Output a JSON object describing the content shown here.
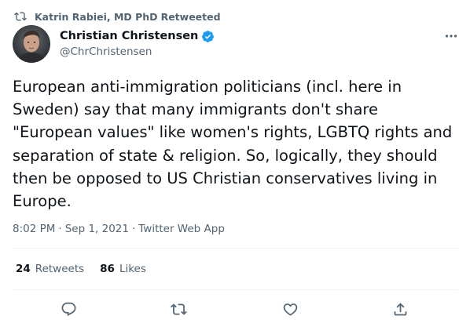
{
  "retweet_context": {
    "name": "Katrin Rabiei, MD PhD",
    "label": "Retweeted",
    "icon": "retweet-icon"
  },
  "author": {
    "display_name": "Christian Christensen",
    "handle": "@ChrChristensen",
    "verified_icon": "verified-badge-icon",
    "verified_color": "#1d9bf0"
  },
  "tweet": {
    "text": "European anti-immigration politicians (incl. here in Sweden) say that many immigrants don't share \"European values\" like women's rights, LGBTQ rights and separation of state & religion. So, logically, they should then be opposed to US Christian conservatives living in Europe.",
    "time": "8:02 PM",
    "date": "Sep 1, 2021",
    "source": "Twitter Web App"
  },
  "stats": {
    "retweets_count": "24",
    "retweets_label": "Retweets",
    "likes_count": "86",
    "likes_label": "Likes"
  },
  "actions": [
    "reply-icon",
    "retweet-icon",
    "like-icon",
    "share-icon"
  ],
  "colors": {
    "text_primary": "#0f1419",
    "text_secondary": "#536471",
    "divider": "#eff3f4",
    "accent": "#1d9bf0"
  }
}
